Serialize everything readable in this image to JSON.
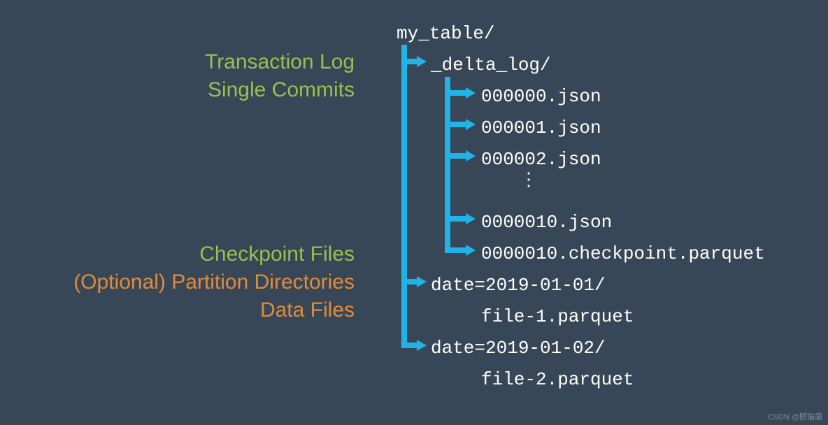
{
  "labels": {
    "transaction_log": "Transaction Log",
    "single_commits": "Single Commits",
    "checkpoint_files": "Checkpoint Files",
    "partition_dirs": "(Optional) Partition Directories",
    "data_files": "Data Files"
  },
  "tree": {
    "root": "my_table/",
    "delta_log_dir": "_delta_log/",
    "commits": {
      "c0": "000000.json",
      "c1": "000001.json",
      "c2": "000002.json",
      "c10": "0000010.json"
    },
    "checkpoint": "0000010.checkpoint.parquet",
    "partition1": "date=2019-01-01/",
    "file1": "file-1.parquet",
    "partition2": "date=2019-01-02/",
    "file2": "file-2.parquet"
  },
  "colors": {
    "bg": "#374758",
    "green": "#9bbf4f",
    "orange": "#e08b3a",
    "tree": "#22b3e6"
  },
  "watermark": "CSDN @肥猫菌"
}
